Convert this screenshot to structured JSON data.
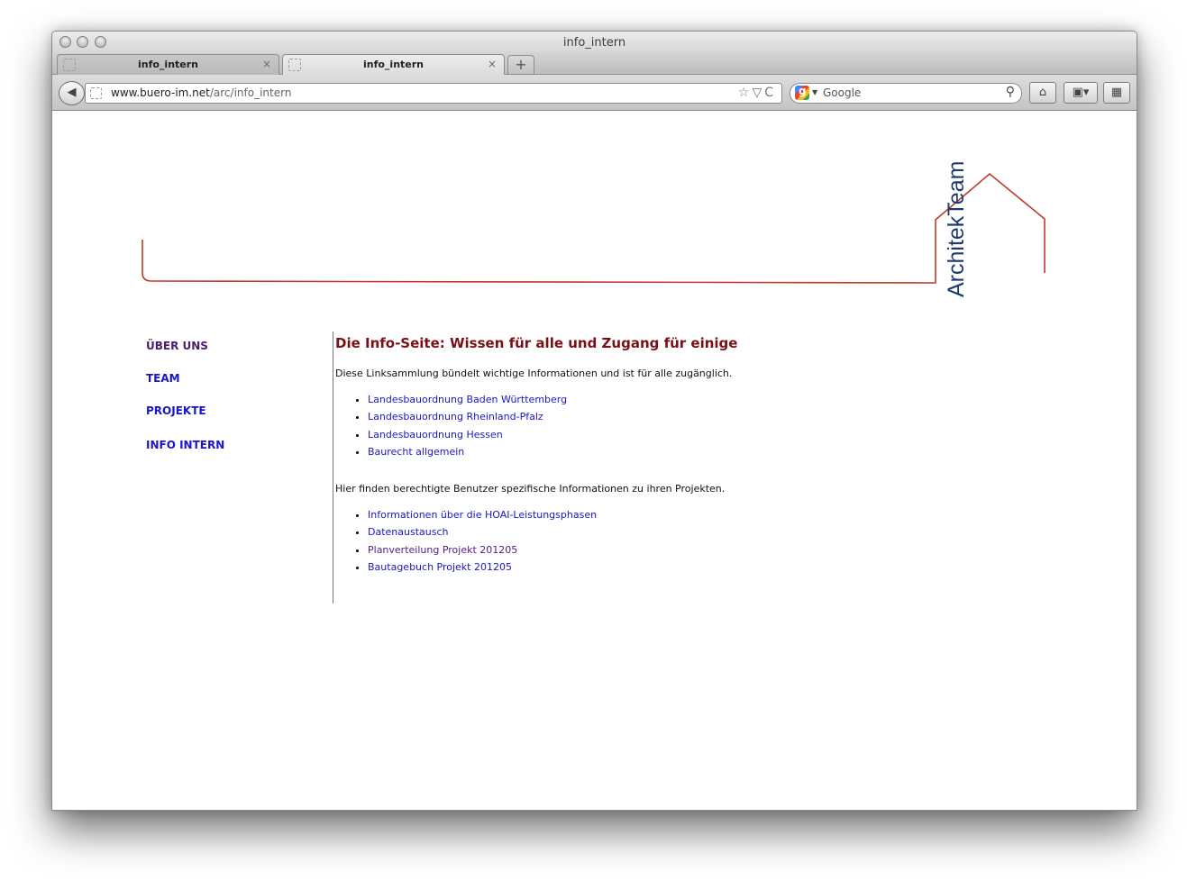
{
  "window": {
    "title": "info_intern"
  },
  "tabs": [
    {
      "label": "info_intern",
      "close": "×"
    },
    {
      "label": "info_intern",
      "close": "×"
    }
  ],
  "newtab_label": "+",
  "toolbar": {
    "back_label": "◀",
    "url_domain": "www.buero-im.net",
    "url_path": "/arc/info_intern",
    "url_icons": "☆▽C",
    "search_placeholder": "Google",
    "search_icon": "⚲",
    "home_label": "⌂",
    "bookmarks_label": "▣▾",
    "extension_label": "▦"
  },
  "logo": {
    "text": "ArchitekTeam",
    "text_color": "#1d3a6d",
    "line_color": "#c0392b"
  },
  "nav": {
    "items": [
      {
        "label": "ÜBER UNS",
        "color": "#4b1c6b"
      },
      {
        "label": "TEAM",
        "color": "#1a16c8"
      },
      {
        "label": "PROJEKTE",
        "color": "#1a16c8"
      },
      {
        "label": "INFO INTERN",
        "color": "#1a16c8"
      }
    ]
  },
  "content": {
    "heading": "Die Info-Seite: Wissen für alle und Zugang für einige",
    "heading_color": "#7a1016",
    "intro": "Diese Linksammlung bündelt wichtige Informationen und ist für alle zugänglich.",
    "public_links": [
      {
        "label": "Landesbauordnung Baden Württemberg",
        "color": "#1a16c8"
      },
      {
        "label": "Landesbauordnung Rheinland-Pfalz",
        "color": "#1a16c8"
      },
      {
        "label": "Landesbauordnung Hessen",
        "color": "#1a16c8"
      },
      {
        "label": "Baurecht allgemein",
        "color": "#1a16c8"
      }
    ],
    "private_intro": "Hier finden berechtigte Benutzer spezifische Informationen zu ihren Projekten.",
    "private_links": [
      {
        "label": "Informationen über die HOAI-Leistungsphasen",
        "color": "#1a16c8"
      },
      {
        "label": "Datenaustausch",
        "color": "#1a16c8"
      },
      {
        "label": "Planverteilung Projekt 201205",
        "color": "#551a8b"
      },
      {
        "label": "Bautagebuch Projekt 201205",
        "color": "#1a16c8"
      }
    ]
  }
}
